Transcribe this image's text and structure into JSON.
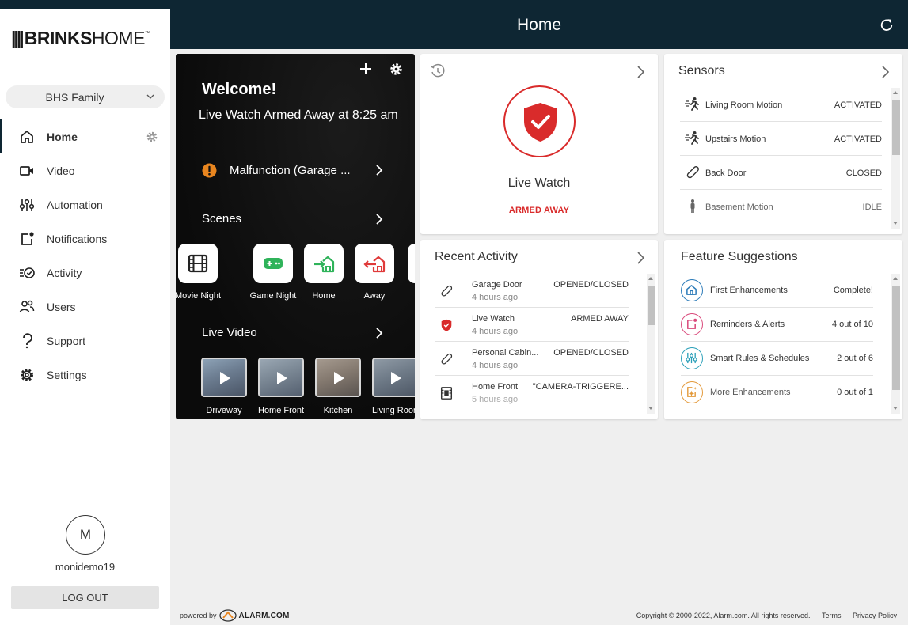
{
  "app": {
    "logo_bars": "||||",
    "logo_brinks": "BRINKS",
    "logo_home": "HOME",
    "logo_tm": "™"
  },
  "header": {
    "title": "Home",
    "refresh_icon": "refresh-icon"
  },
  "sidebar": {
    "account": "BHS Family",
    "items": [
      {
        "label": "Home",
        "icon": "home-icon",
        "active": true
      },
      {
        "label": "Video",
        "icon": "video-camera-icon"
      },
      {
        "label": "Automation",
        "icon": "sliders-icon"
      },
      {
        "label": "Notifications",
        "icon": "notification-icon"
      },
      {
        "label": "Activity",
        "icon": "activity-icon"
      },
      {
        "label": "Users",
        "icon": "users-icon"
      },
      {
        "label": "Support",
        "icon": "support-icon"
      },
      {
        "label": "Settings",
        "icon": "settings-icon"
      }
    ],
    "avatar_initial": "M",
    "username": "monidemo19",
    "logout": "LOG OUT"
  },
  "welcome": {
    "title": "Welcome!",
    "status": "Live Watch Armed Away at 8:25 am",
    "malfunction": "Malfunction (Garage ...",
    "scenes_title": "Scenes",
    "scenes": [
      {
        "label": "Movie Night",
        "icon": "film-icon"
      },
      {
        "label": "Game Night",
        "icon": "gamepad-icon"
      },
      {
        "label": "Home",
        "icon": "arrive-home-icon"
      },
      {
        "label": "Away",
        "icon": "leave-home-icon"
      }
    ],
    "live_video_title": "Live Video",
    "cameras": [
      {
        "label": "Driveway"
      },
      {
        "label": "Home Front"
      },
      {
        "label": "Kitchen"
      },
      {
        "label": "Living Room"
      }
    ]
  },
  "live_watch": {
    "title": "Live Watch",
    "state": "ARMED AWAY",
    "state_color": "#d92b2b"
  },
  "sensors": {
    "title": "Sensors",
    "rows": [
      {
        "name": "Living Room Motion",
        "value": "ACTIVATED",
        "icon": "motion-icon"
      },
      {
        "name": "Upstairs Motion",
        "value": "ACTIVATED",
        "icon": "motion-icon"
      },
      {
        "name": "Back Door",
        "value": "CLOSED",
        "icon": "door-sensor-icon"
      },
      {
        "name": "Basement Motion",
        "value": "IDLE",
        "icon": "person-icon"
      }
    ]
  },
  "recent_activity": {
    "title": "Recent Activity",
    "rows": [
      {
        "name": "Garage Door",
        "time": "4 hours ago",
        "value": "OPENED/CLOSED",
        "icon": "door-sensor-icon"
      },
      {
        "name": "Live Watch",
        "time": "4 hours ago",
        "value": "ARMED AWAY",
        "icon": "shield-icon"
      },
      {
        "name": "Personal Cabin...",
        "time": "4 hours ago",
        "value": "OPENED/CLOSED",
        "icon": "door-sensor-icon"
      },
      {
        "name": "Home Front",
        "time": "5 hours ago",
        "value": "\"CAMERA-TRIGGERE...",
        "icon": "video-clip-icon"
      }
    ]
  },
  "feature_suggestions": {
    "title": "Feature Suggestions",
    "rows": [
      {
        "name": "First Enhancements",
        "value": "Complete!",
        "icon": "home-icon",
        "color": "#2a7ab8"
      },
      {
        "name": "Reminders & Alerts",
        "value": "4 out of 10",
        "icon": "notification-icon",
        "color": "#d9487a"
      },
      {
        "name": "Smart Rules & Schedules",
        "value": "2 out of 6",
        "icon": "sliders-icon",
        "color": "#2a9fb8"
      },
      {
        "name": "More Enhancements",
        "value": "0 out of 1",
        "icon": "sparkle-icon",
        "color": "#e39a3b"
      }
    ]
  },
  "footer": {
    "powered_by": "powered by",
    "alarm_brand": "ALARM.COM",
    "copyright": "Copyright © 2000-2022, Alarm.com. All rights reserved.",
    "terms": "Terms",
    "privacy": "Privacy Policy"
  }
}
